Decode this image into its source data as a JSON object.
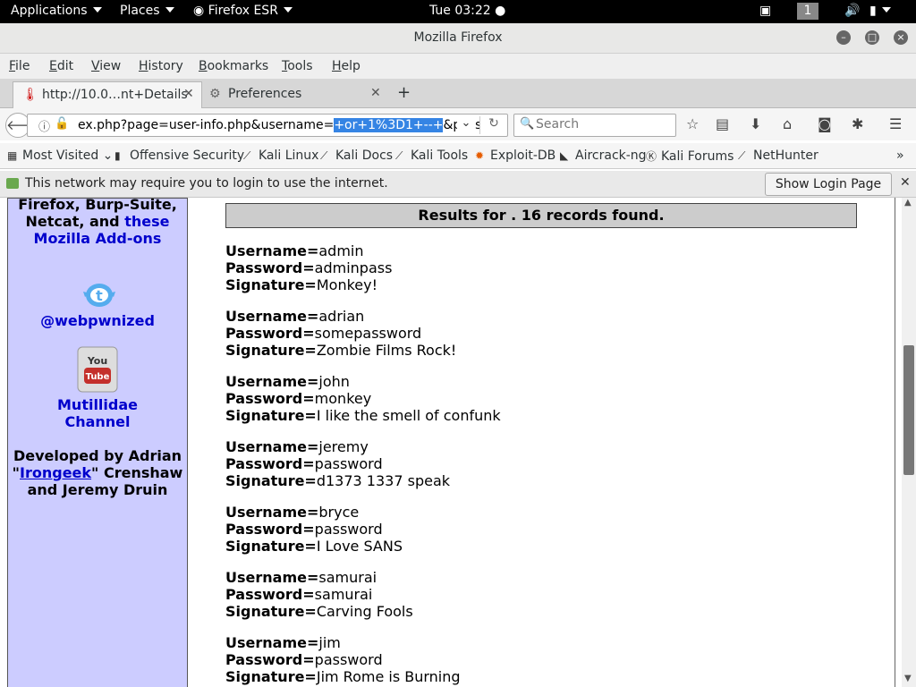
{
  "topbar": {
    "applications": "Applications",
    "places": "Places",
    "app_menu": "Firefox ESR",
    "clock": "Tue 03:22",
    "workspace": "1"
  },
  "window": {
    "title": "Mozilla Firefox"
  },
  "menubar": {
    "items": [
      "File",
      "Edit",
      "View",
      "History",
      "Bookmarks",
      "Tools",
      "Help"
    ]
  },
  "tabs": [
    {
      "label": "http://10.0…nt+Details"
    },
    {
      "label": "Preferences"
    }
  ],
  "url": {
    "before": "ex.php?page=user-info.php&username=",
    "selected": "+or+1%3D1+--+",
    "after": "&passw"
  },
  "search": {
    "placeholder": "Search"
  },
  "bookmarks": [
    "Most Visited",
    "Offensive Security",
    "Kali Linux",
    "Kali Docs",
    "Kali Tools",
    "Exploit-DB",
    "Aircrack-ng",
    "Kali Forums",
    "NetHunter"
  ],
  "notification": {
    "text": "This network may require you to login to use the internet.",
    "button": "Show Login Page"
  },
  "sidebar": {
    "l1": "Firefox, Burp-Suite,",
    "l2a": "Netcat, and ",
    "l2b": "these",
    "l3": "Mozilla Add-ons",
    "twitter": "@webpwnized",
    "youtube_l1": "Mutillidae",
    "youtube_l2": "Channel",
    "dev_l1": "Developed by Adrian",
    "dev_q1": "\"",
    "dev_link": "Irongeek",
    "dev_q2": "\" Crenshaw",
    "dev_l3": "and Jeremy Druin"
  },
  "results": {
    "header": "Results for . 16 records found.",
    "labels": {
      "username": "Username=",
      "password": "Password=",
      "signature": "Signature="
    },
    "records": [
      {
        "username": "admin",
        "password": "adminpass",
        "signature": "Monkey!"
      },
      {
        "username": "adrian",
        "password": "somepassword",
        "signature": "Zombie Films Rock!"
      },
      {
        "username": "john",
        "password": "monkey",
        "signature": "I like the smell of confunk"
      },
      {
        "username": "jeremy",
        "password": "password",
        "signature": "d1373 1337 speak"
      },
      {
        "username": "bryce",
        "password": "password",
        "signature": "I Love SANS"
      },
      {
        "username": "samurai",
        "password": "samurai",
        "signature": "Carving Fools"
      },
      {
        "username": "jim",
        "password": "password",
        "signature": "Jim Rome is Burning"
      }
    ]
  }
}
